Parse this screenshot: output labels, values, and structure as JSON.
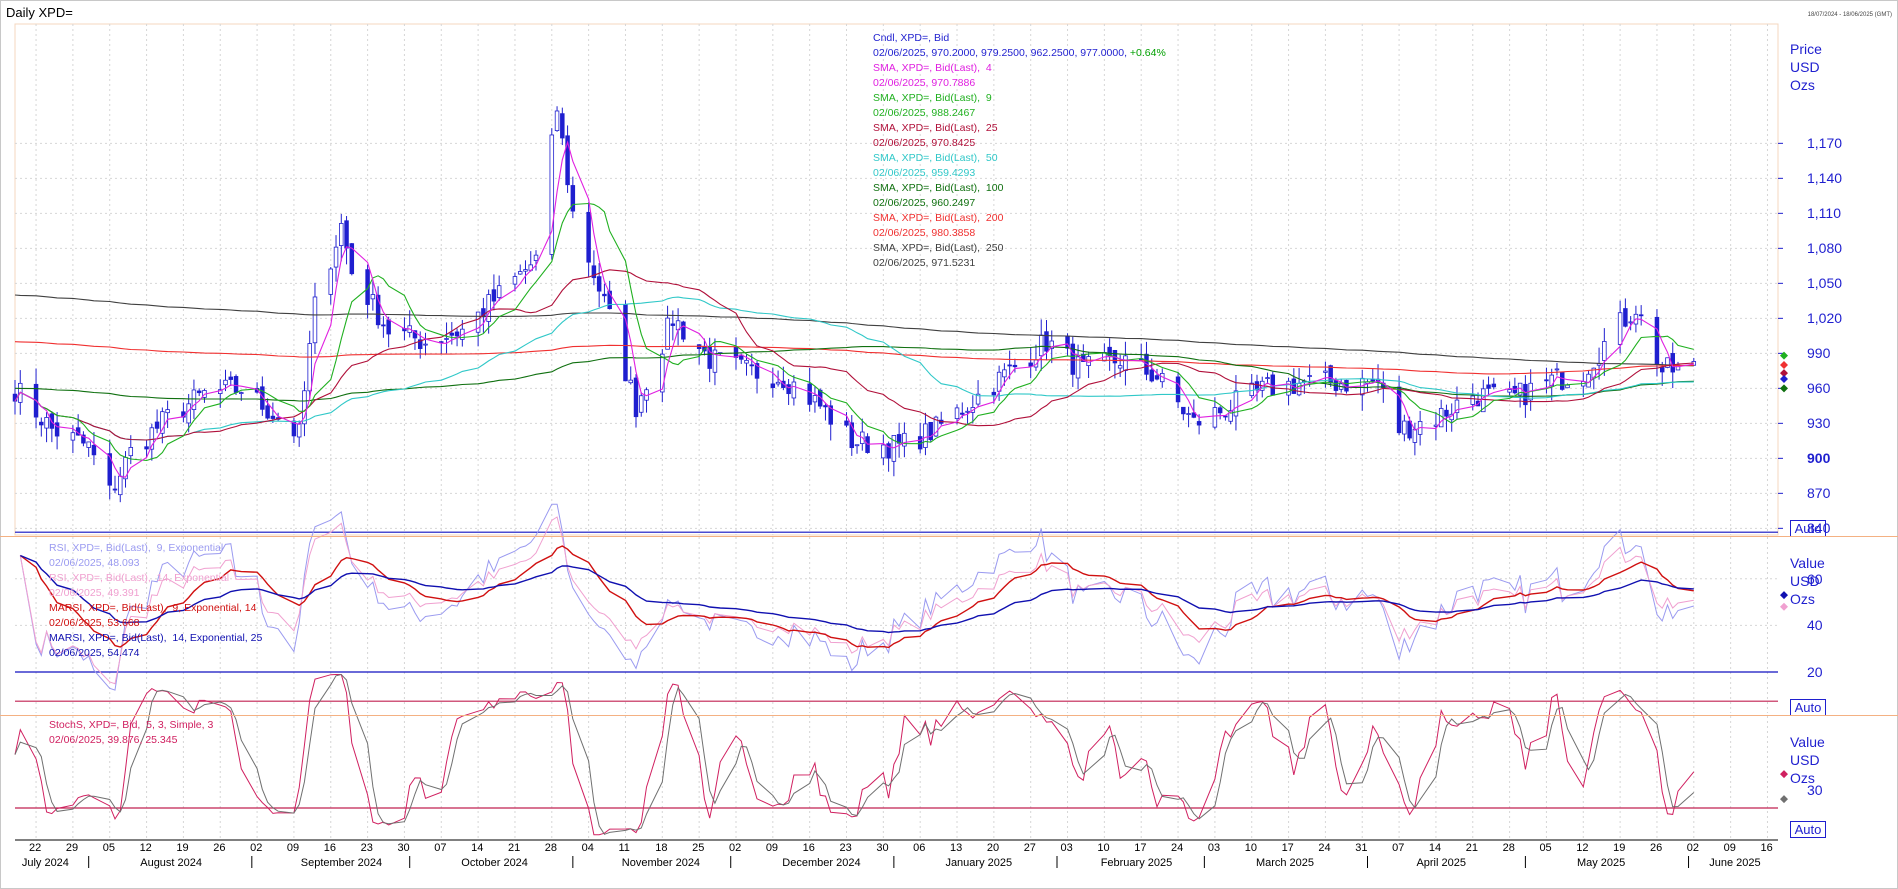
{
  "window": {
    "title": "Daily XPD=",
    "range": "18/07/2024 - 18/06/2025 (GMT)"
  },
  "legend_main": [
    {
      "text": "Cndl, XPD=, Bid",
      "color": "#1f1fcf"
    },
    {
      "text": "02/06/2025, 970.2000, 979.2500, 962.2500, 977.0000, +0.64%",
      "color": "#1f1fcf",
      "extra": "+0.64%",
      "extraColor": "#00a000"
    },
    {
      "text": "SMA, XPD=, Bid(Last),  4",
      "color": "#e020e0"
    },
    {
      "text": "02/06/2025, 970.7886",
      "color": "#e020e0"
    },
    {
      "text": "SMA, XPD=, Bid(Last),  9",
      "color": "#20b020"
    },
    {
      "text": "02/06/2025, 988.2467",
      "color": "#20b020"
    },
    {
      "text": "SMA, XPD=, Bid(Last),  25",
      "color": "#b0103a"
    },
    {
      "text": "02/06/2025, 970.8425",
      "color": "#b0103a"
    },
    {
      "text": "SMA, XPD=, Bid(Last),  50",
      "color": "#30c8c8"
    },
    {
      "text": "02/06/2025, 959.4293",
      "color": "#30c8c8"
    },
    {
      "text": "SMA, XPD=, Bid(Last),  100",
      "color": "#107010"
    },
    {
      "text": "02/06/2025, 960.2497",
      "color": "#107010"
    },
    {
      "text": "SMA, XPD=, Bid(Last),  200",
      "color": "#f03030"
    },
    {
      "text": "02/06/2025, 980.3858",
      "color": "#f03030"
    },
    {
      "text": "SMA, XPD=, Bid(Last),  250",
      "color": "#404040"
    },
    {
      "text": "02/06/2025, 971.5231",
      "color": "#404040"
    }
  ],
  "legend_rsi": [
    {
      "text": "RSI, XPD=, Bid(Last),  9, Exponential",
      "color": "#9a9af0"
    },
    {
      "text": "02/06/2025, 48.093",
      "color": "#9a9af0"
    },
    {
      "text": "RSI, XPD=, Bid(Last),  14, Exponential",
      "color": "#f0a0d0"
    },
    {
      "text": "02/06/2025, 49.391",
      "color": "#f0a0d0"
    },
    {
      "text": "MARSI, XPD=, Bid(Last),  9, Exponential, 14",
      "color": "#d01010"
    },
    {
      "text": "02/06/2025, 53.668",
      "color": "#d01010"
    },
    {
      "text": "MARSI, XPD=, Bid(Last),  14, Exponential, 25",
      "color": "#1010b0"
    },
    {
      "text": "02/06/2025, 54.474",
      "color": "#1010b0"
    }
  ],
  "legend_stoch": [
    {
      "text": "StochS, XPD=, Bid,  5, 3, Simple, 3",
      "color": "#d02060"
    },
    {
      "text": "02/06/2025, 39.876, 25.345",
      "color": "#d02060"
    }
  ],
  "axis_main": {
    "header": [
      "Price",
      "USD",
      "Ozs"
    ],
    "ticks": [
      "1,170",
      "1,140",
      "1,110",
      "1,080",
      "1,050",
      "1,020",
      "990",
      "960",
      "930",
      "900",
      "870",
      "840"
    ],
    "auto": "Auto"
  },
  "axis_rsi": {
    "header": [
      "Value",
      "USD",
      "Ozs"
    ],
    "ticks": [
      "60",
      "40",
      "20"
    ],
    "auto": "Auto"
  },
  "axis_stoch": {
    "header": [
      "Value",
      "USD",
      "Ozs"
    ],
    "ticks": [
      "30"
    ],
    "auto": "Auto"
  },
  "x_days": [
    "22",
    "29",
    "05",
    "12",
    "19",
    "26",
    "02",
    "09",
    "16",
    "23",
    "30",
    "07",
    "14",
    "21",
    "28",
    "04",
    "11",
    "18",
    "25",
    "02",
    "09",
    "16",
    "23",
    "30",
    "06",
    "13",
    "20",
    "27",
    "03",
    "10",
    "17",
    "24",
    "03",
    "10",
    "17",
    "24",
    "31",
    "07",
    "14",
    "21",
    "28",
    "05",
    "12",
    "19",
    "26",
    "02",
    "09",
    "16"
  ],
  "x_months": [
    "July 2024",
    "August 2024",
    "September 2024",
    "October 2024",
    "November 2024",
    "December 2024",
    "January 2025",
    "February 2025",
    "March 2025",
    "April 2025",
    "May 2025",
    "June 2025"
  ],
  "chart_data": [
    {
      "type": "candlestick",
      "title": "Daily XPD=",
      "ylabel": "Price USD Ozs",
      "ylim": [
        820,
        1230
      ],
      "x_start": "2024-07-18",
      "x_end": "2025-06-18",
      "close_weekly": [
        {
          "date": "2024-07-18",
          "c": 960
        },
        {
          "date": "2024-07-25",
          "c": 925
        },
        {
          "date": "2024-08-01",
          "c": 910
        },
        {
          "date": "2024-08-05",
          "c": 870
        },
        {
          "date": "2024-08-09",
          "c": 905
        },
        {
          "date": "2024-08-16",
          "c": 935
        },
        {
          "date": "2024-08-23",
          "c": 955
        },
        {
          "date": "2024-08-30",
          "c": 960
        },
        {
          "date": "2024-09-06",
          "c": 935
        },
        {
          "date": "2024-09-10",
          "c": 920
        },
        {
          "date": "2024-09-13",
          "c": 1030
        },
        {
          "date": "2024-09-18",
          "c": 1100
        },
        {
          "date": "2024-09-20",
          "c": 1060
        },
        {
          "date": "2024-09-27",
          "c": 1010
        },
        {
          "date": "2024-10-04",
          "c": 1000
        },
        {
          "date": "2024-10-11",
          "c": 1010
        },
        {
          "date": "2024-10-18",
          "c": 1040
        },
        {
          "date": "2024-10-25",
          "c": 1070
        },
        {
          "date": "2024-10-29",
          "c": 1200
        },
        {
          "date": "2024-11-01",
          "c": 1110
        },
        {
          "date": "2024-11-08",
          "c": 1020
        },
        {
          "date": "2024-11-13",
          "c": 945
        },
        {
          "date": "2024-11-20",
          "c": 1020
        },
        {
          "date": "2024-11-27",
          "c": 985
        },
        {
          "date": "2024-12-04",
          "c": 975
        },
        {
          "date": "2024-12-11",
          "c": 970
        },
        {
          "date": "2024-12-18",
          "c": 945
        },
        {
          "date": "2024-12-24",
          "c": 915
        },
        {
          "date": "2025-01-02",
          "c": 910
        },
        {
          "date": "2025-01-09",
          "c": 925
        },
        {
          "date": "2025-01-16",
          "c": 950
        },
        {
          "date": "2025-01-23",
          "c": 975
        },
        {
          "date": "2025-01-30",
          "c": 1000
        },
        {
          "date": "2025-02-06",
          "c": 975
        },
        {
          "date": "2025-02-13",
          "c": 985
        },
        {
          "date": "2025-02-20",
          "c": 970
        },
        {
          "date": "2025-02-27",
          "c": 930
        },
        {
          "date": "2025-03-06",
          "c": 945
        },
        {
          "date": "2025-03-13",
          "c": 960
        },
        {
          "date": "2025-03-20",
          "c": 965
        },
        {
          "date": "2025-03-27",
          "c": 965
        },
        {
          "date": "2025-04-03",
          "c": 965
        },
        {
          "date": "2025-04-07",
          "c": 925
        },
        {
          "date": "2025-04-14",
          "c": 935
        },
        {
          "date": "2025-04-21",
          "c": 955
        },
        {
          "date": "2025-04-28",
          "c": 950
        },
        {
          "date": "2025-05-05",
          "c": 965
        },
        {
          "date": "2025-05-12",
          "c": 975
        },
        {
          "date": "2025-05-19",
          "c": 1015
        },
        {
          "date": "2025-05-22",
          "c": 1030
        },
        {
          "date": "2025-05-27",
          "c": 975
        },
        {
          "date": "2025-06-02",
          "c": 977
        }
      ],
      "series": [
        {
          "name": "SMA, XPD=, Bid(Last),  250",
          "color": "#404040",
          "last": 971.5231
        },
        {
          "name": "SMA, XPD=, Bid(Last),  200",
          "color": "#f03030",
          "last": 980.3858
        },
        {
          "name": "SMA, XPD=, Bid(Last),  100",
          "color": "#107010",
          "last": 960.2497
        },
        {
          "name": "SMA, XPD=, Bid(Last),  50",
          "color": "#30c8c8",
          "last": 959.4293
        },
        {
          "name": "SMA, XPD=, Bid(Last),  25",
          "color": "#b0103a",
          "last": 970.8425
        },
        {
          "name": "SMA, XPD=, Bid(Last),  9",
          "color": "#20b020",
          "last": 988.2467
        },
        {
          "name": "SMA, XPD=, Bid(Last),  4",
          "color": "#e020e0",
          "last": 970.7886
        }
      ]
    },
    {
      "type": "line",
      "title": "RSI",
      "ylim": [
        5,
        100
      ],
      "series": [
        {
          "name": "RSI, XPD=, Bid(Last),  9, Exponential",
          "color": "#9a9af0",
          "last": 48.093
        },
        {
          "name": "RSI, XPD=, Bid(Last),  14, Exponential",
          "color": "#f0a0d0",
          "last": 49.391
        },
        {
          "name": "MARSI, XPD=, Bid(Last),  9, Exponential, 14",
          "color": "#d01010",
          "last": 53.668
        },
        {
          "name": "MARSI, XPD=, Bid(Last),  14, Exponential, 25",
          "color": "#1010b0",
          "last": 54.474
        }
      ],
      "levels": [
        80,
        20
      ]
    },
    {
      "type": "line",
      "title": "StochS",
      "ylim": [
        0,
        100
      ],
      "series": [
        {
          "name": "StochS %K",
          "color": "#d02060",
          "last": 39.876
        },
        {
          "name": "StochS %D",
          "color": "#707070",
          "last": 25.345
        }
      ],
      "levels": [
        80,
        20
      ]
    }
  ]
}
